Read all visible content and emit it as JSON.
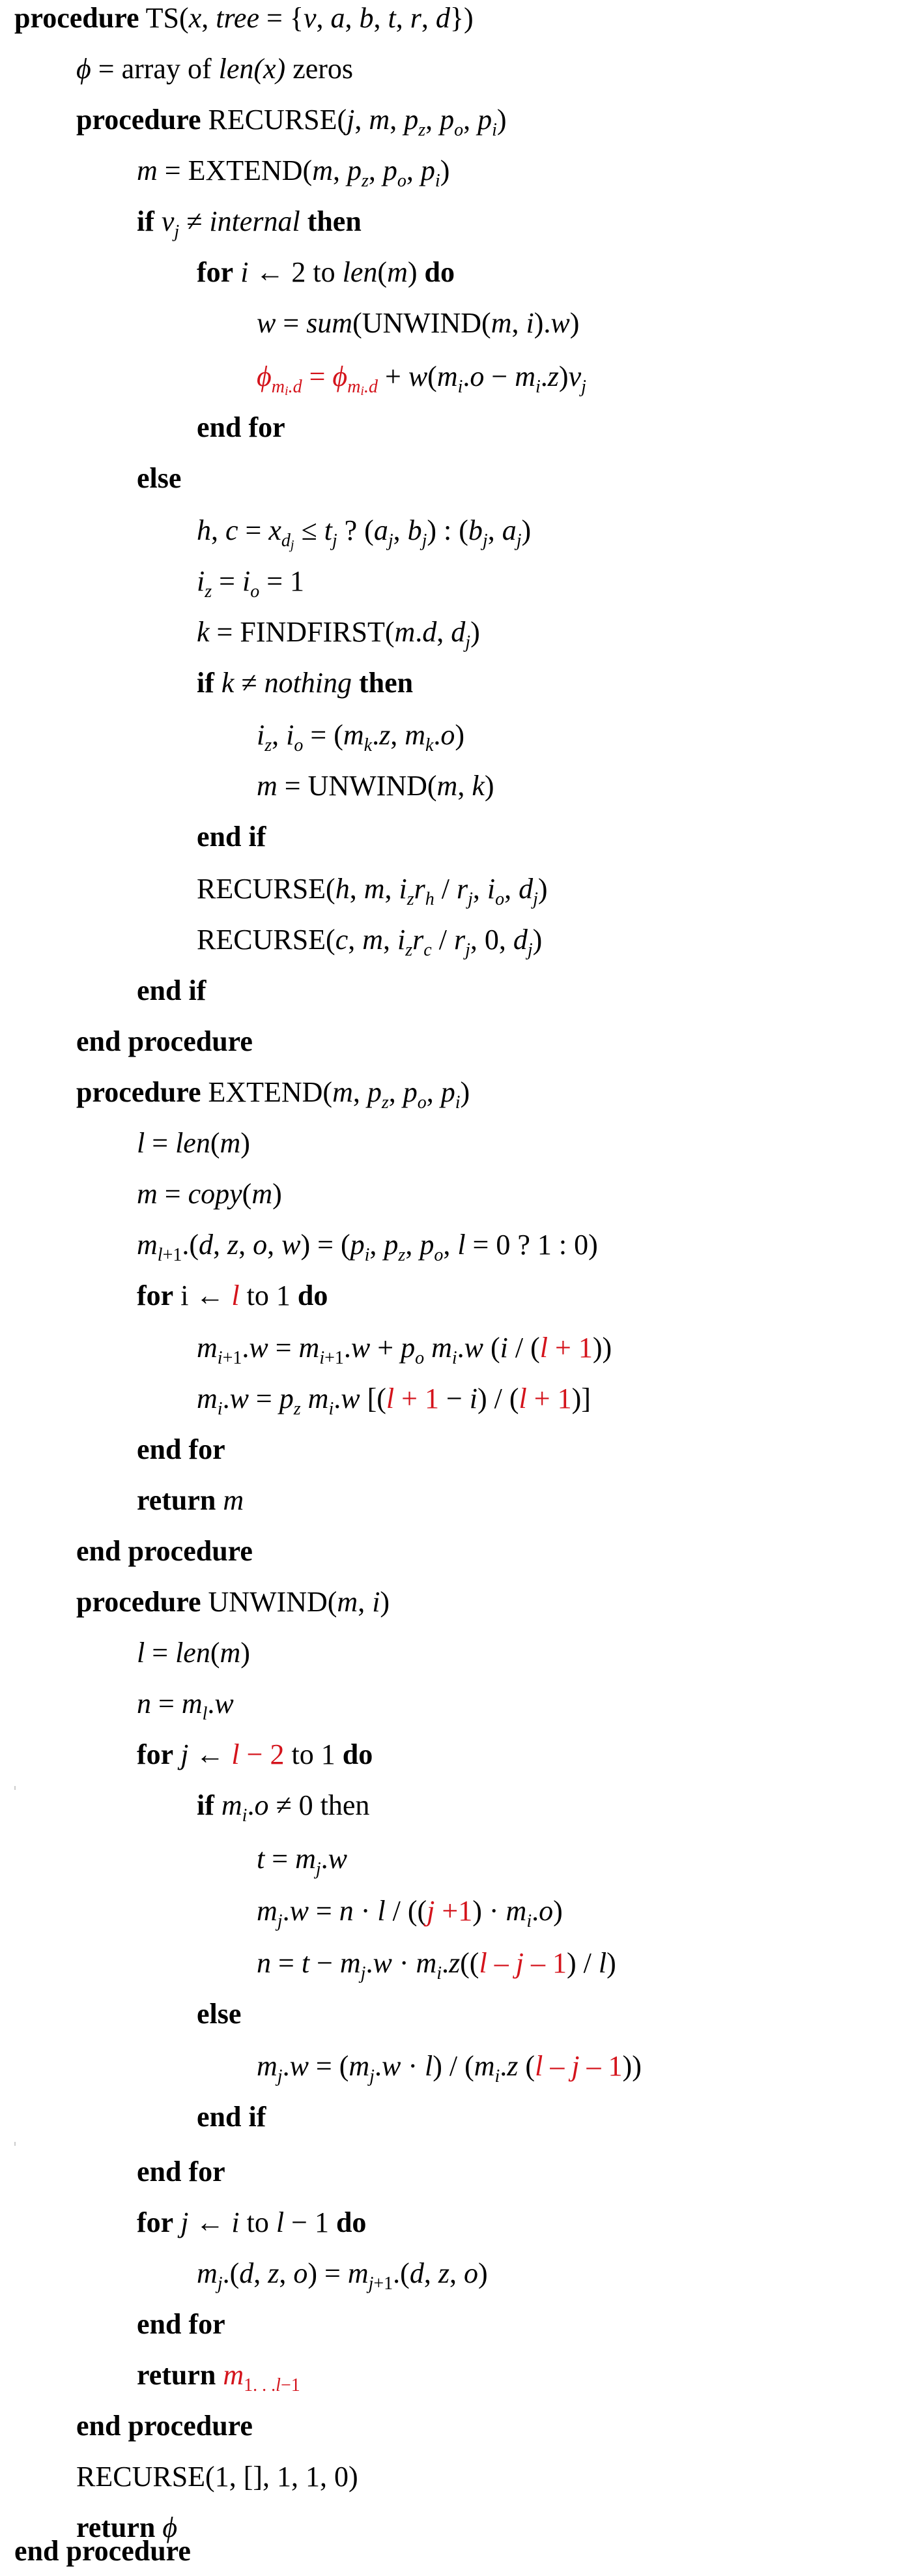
{
  "kw": {
    "procedure": "procedure",
    "if": "if",
    "then": "then",
    "for": "for",
    "do": "do",
    "end_for": "end for",
    "else": "else",
    "end_if": "end if",
    "end_procedure": "end procedure",
    "return": "return"
  },
  "lines": {
    "ts_name": "TS(",
    "ts_args": "x, tree",
    "ts_set": " = {",
    "ts_set_items": "v, a, b, t, r, d",
    "ts_close": "})",
    "phi": "ϕ",
    "phi_init_1": " = array of ",
    "phi_init_2": "len(x)",
    "phi_init_3": " zeros",
    "recurse_name": "RECURSE(",
    "recurse_args": "j, m, p",
    "extend_call": "m = EXTEND(m, p",
    "unwind_call": "UNWIND(",
    "findfirst": "FINDFIRST(",
    "nothing": "nothing",
    "internal": "internal",
    "recurse_h": "RECURSE(",
    "recurse_c": "RECURSE(",
    "extend_name": "EXTEND(",
    "unwind_name": "UNWIND(",
    "final_call": "RECURSE(1, [], 1, 1, 0)"
  }
}
